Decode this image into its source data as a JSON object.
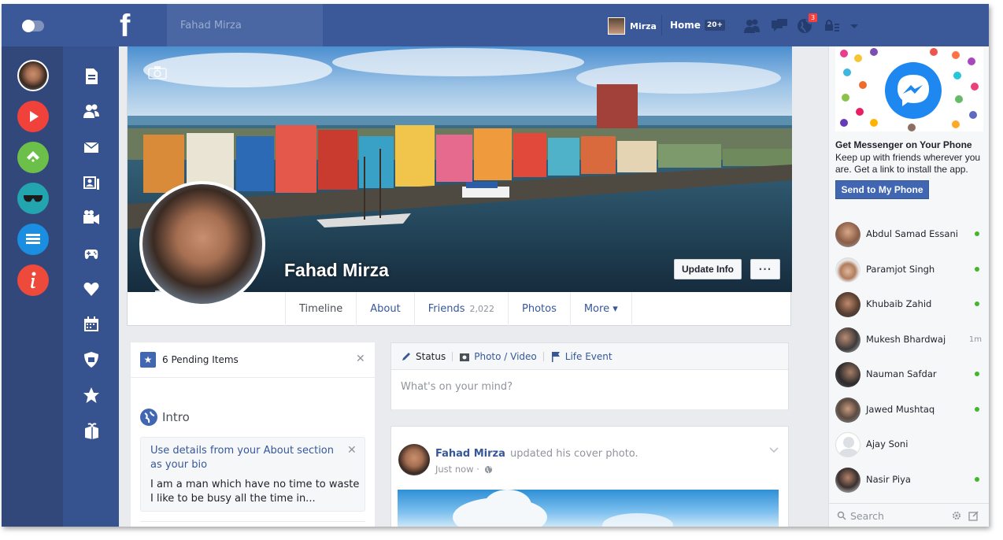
{
  "topbar": {
    "logo": "f",
    "search_placeholder": "Fahad Mirza",
    "user_name": "Mirza",
    "home_label": "Home",
    "home_count": "20+",
    "notification_count": "3"
  },
  "profile": {
    "name": "Fahad Mirza",
    "update_info_label": "Update Info",
    "more_actions_label": "···"
  },
  "tabs": [
    {
      "label": "Timeline"
    },
    {
      "label": "About"
    },
    {
      "label": "Friends",
      "count": "2,022"
    },
    {
      "label": "Photos"
    },
    {
      "label": "More ▾"
    }
  ],
  "pending": {
    "text": "6 Pending Items",
    "close": "✕"
  },
  "intro": {
    "title": "Intro",
    "hint": "Use details from your About section as your bio",
    "close": "✕",
    "bio_line1": "I am a man which have no time to waste",
    "bio_line2": "I like to be busy all the time in..."
  },
  "composer": {
    "tab_status": "Status",
    "tab_photo": "Photo / Video",
    "tab_life": "Life Event",
    "placeholder": "What's on your mind?"
  },
  "post": {
    "author": "Fahad Mirza",
    "action": "updated his cover photo.",
    "time": "Just now ·"
  },
  "ad": {
    "title": "Get Messenger on Your Phone",
    "body": "Keep up with friends wherever you are. Get a link to install the app.",
    "button": "Send to My Phone"
  },
  "chat": {
    "contacts": [
      {
        "name": "Abdul Samad Essani",
        "status": "online"
      },
      {
        "name": "Paramjot Singh",
        "status": "online"
      },
      {
        "name": "Khubaib Zahid",
        "status": "online"
      },
      {
        "name": "Mukesh Bhardwaj",
        "status": "1m"
      },
      {
        "name": "Nauman Safdar",
        "status": "online"
      },
      {
        "name": "Jawed Mushtaq",
        "status": "online"
      },
      {
        "name": "Ajay Soni",
        "status": ""
      },
      {
        "name": "Nasir Piya",
        "status": "online"
      }
    ],
    "search_label": "Search"
  },
  "icons": {
    "app_bar": [
      "profile-avatar",
      "play-icon",
      "feedly-icon",
      "sunglasses-icon",
      "list-icon",
      "info-icon"
    ],
    "nav_bar": [
      "document-icon",
      "friends-icon",
      "envelope-icon",
      "photos-icon",
      "video-camera-icon",
      "gamepad-icon",
      "heart-icon",
      "calendar-icon",
      "shield-icon",
      "star-icon",
      "gift-icon"
    ]
  },
  "colors": {
    "brand_blue": "#3b5998",
    "app_bar_bg": "#33487a",
    "nav_bar_bg": "#36538f",
    "online_green": "#42b72a",
    "notification_red": "#fa3e3e"
  }
}
